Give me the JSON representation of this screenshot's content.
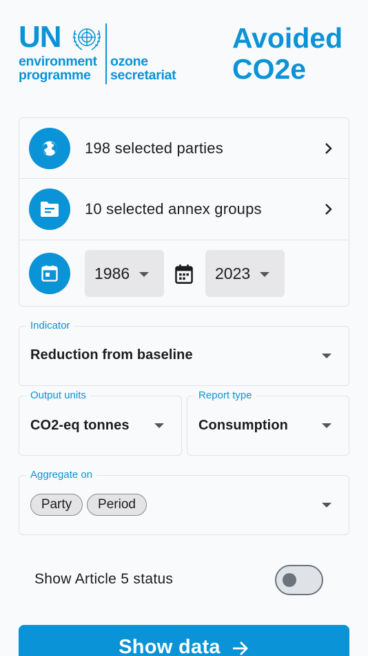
{
  "header": {
    "logo": {
      "un": "UN",
      "left_line1": "environment",
      "left_line2": "programme",
      "right_line1": "ozone",
      "right_line2": "secretariat"
    },
    "title_line1": "Avoided",
    "title_line2": "CO2e"
  },
  "selection": {
    "parties": {
      "label": "198 selected parties",
      "icon": "globe-icon"
    },
    "annex_groups": {
      "label": "10 selected annex groups",
      "icon": "folder-icon"
    },
    "period": {
      "icon": "calendar-icon",
      "start_year": "1986",
      "end_year": "2023"
    }
  },
  "indicator": {
    "label": "Indicator",
    "value": "Reduction from baseline"
  },
  "output_units": {
    "label": "Output units",
    "value": "CO2-eq tonnes"
  },
  "report_type": {
    "label": "Report type",
    "value": "Consumption"
  },
  "aggregate": {
    "label": "Aggregate on",
    "chips": [
      "Party",
      "Period"
    ]
  },
  "article5": {
    "label": "Show Article 5 status",
    "enabled": false
  },
  "show_data": {
    "label": "Show data",
    "icon": "arrow-right-icon"
  },
  "colors": {
    "accent": "#0a93d6",
    "background": "#f9fafc",
    "border": "#e2e4e8"
  }
}
